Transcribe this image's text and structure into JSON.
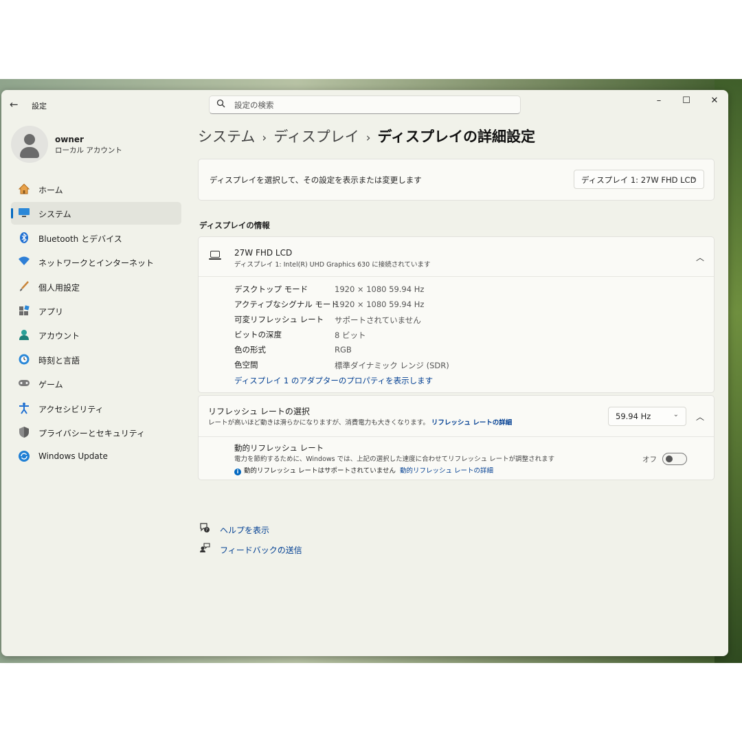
{
  "window": {
    "app_title": "設定",
    "minimize": "–",
    "maximize": "☐",
    "close": "✕"
  },
  "search": {
    "placeholder": "設定の検索"
  },
  "user": {
    "name": "owner",
    "type": "ローカル アカウント"
  },
  "sidebar": {
    "items": [
      {
        "label": "ホーム",
        "icon": "home-icon",
        "selected": false
      },
      {
        "label": "システム",
        "icon": "system-icon",
        "selected": true
      },
      {
        "label": "Bluetooth とデバイス",
        "icon": "bluetooth-icon",
        "selected": false
      },
      {
        "label": "ネットワークとインターネット",
        "icon": "wifi-icon",
        "selected": false
      },
      {
        "label": "個人用設定",
        "icon": "brush-icon",
        "selected": false
      },
      {
        "label": "アプリ",
        "icon": "apps-icon",
        "selected": false
      },
      {
        "label": "アカウント",
        "icon": "account-icon",
        "selected": false
      },
      {
        "label": "時刻と言語",
        "icon": "globe-clock-icon",
        "selected": false
      },
      {
        "label": "ゲーム",
        "icon": "gamepad-icon",
        "selected": false
      },
      {
        "label": "アクセシビリティ",
        "icon": "accessibility-icon",
        "selected": false
      },
      {
        "label": "プライバシーとセキュリティ",
        "icon": "shield-icon",
        "selected": false
      },
      {
        "label": "Windows Update",
        "icon": "windows-update-icon",
        "selected": false
      }
    ]
  },
  "breadcrumb": {
    "items": [
      "システム",
      "ディスプレイ",
      "ディスプレイの詳細設定"
    ],
    "separator": "›"
  },
  "display_select": {
    "text": "ディスプレイを選択して、その設定を表示または変更します",
    "value": "ディスプレイ 1: 27W FHD LCD"
  },
  "display_info": {
    "section_title": "ディスプレイの情報",
    "name": "27W FHD LCD",
    "subtitle": "ディスプレイ 1: Intel(R) UHD Graphics 630 に接続されています",
    "properties": [
      {
        "label": "デスクトップ モード",
        "value": "1920 × 1080 59.94 Hz"
      },
      {
        "label": "アクティブなシグナル モード",
        "value": "1920 × 1080 59.94 Hz"
      },
      {
        "label": "可変リフレッシュ レート",
        "value": "サポートされていません"
      },
      {
        "label": "ビットの深度",
        "value": "8 ビット"
      },
      {
        "label": "色の形式",
        "value": "RGB"
      },
      {
        "label": "色空間",
        "value": "標準ダイナミック レンジ (SDR)"
      }
    ],
    "adapter_link": "ディスプレイ 1 のアダプターのプロパティを表示します"
  },
  "refresh": {
    "title": "リフレッシュ レートの選択",
    "subtitle": "レートが高いほど動きは滑らかになりますが、消費電力も大きくなります。",
    "subtitle_link": "リフレッシュ レートの詳細",
    "value": "59.94 Hz",
    "dynamic_title": "動的リフレッシュ レート",
    "dynamic_sub": "電力を節約するために、Windows では、上記の選択した速度に合わせてリフレッシュ レートが調整されます",
    "dynamic_note": "動的リフレッシュ レートはサポートされていません",
    "dynamic_link": "動的リフレッシュ レートの詳細",
    "toggle_label": "オフ",
    "toggle_on": false
  },
  "footer": {
    "help": "ヘルプを表示",
    "feedback": "フィードバックの送信"
  }
}
